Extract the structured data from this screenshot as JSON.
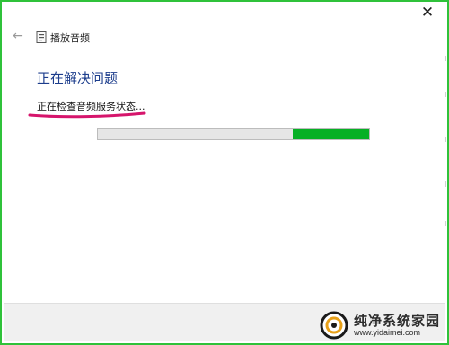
{
  "window": {
    "close_symbol": "✕",
    "back_symbol": "←",
    "title": "播放音频",
    "title_icon": "troubleshooter-icon"
  },
  "content": {
    "heading": "正在解决问题",
    "status": "正在检查音频服务状态...",
    "progress": {
      "mode": "indeterminate",
      "chunk_start_fraction": 0.72,
      "chunk_end_fraction": 1.0,
      "color": "#06b025"
    }
  },
  "annotation": {
    "underline_color": "#d6156c"
  },
  "watermark": {
    "name": "纯净系统家园",
    "url": "www.yidaimei.com"
  },
  "colors": {
    "border": "#2fc23a",
    "heading": "#1c3d8c",
    "footer": "#f0f0f0"
  }
}
